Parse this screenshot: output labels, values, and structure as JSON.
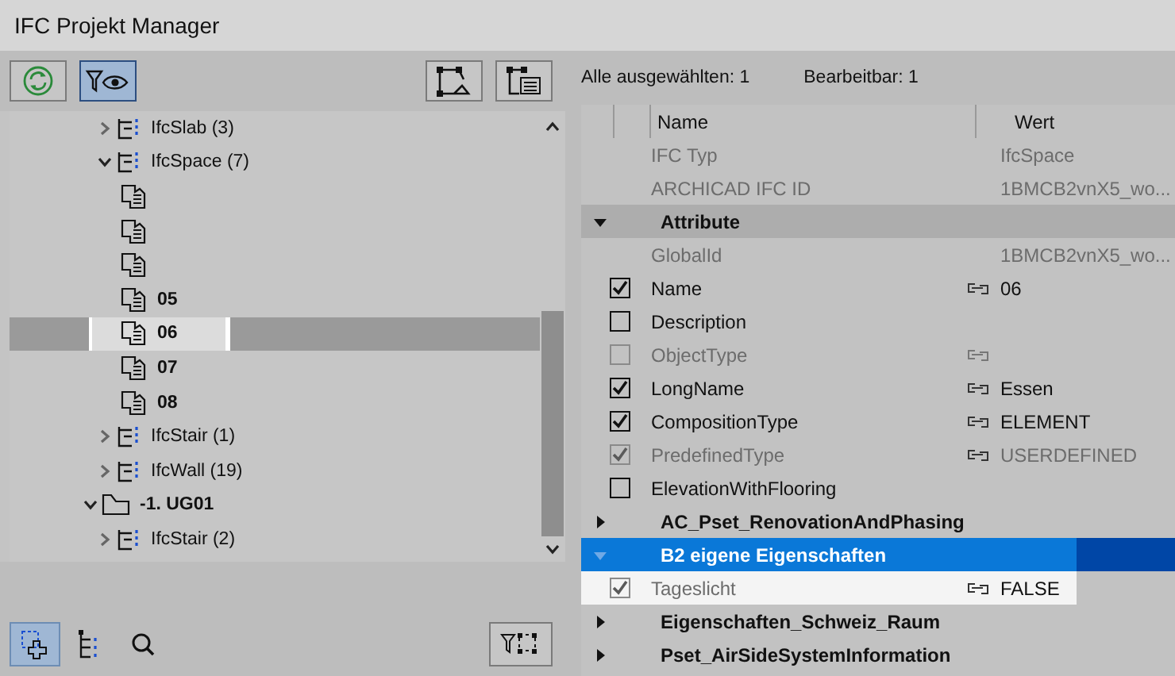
{
  "window": {
    "title": "IFC Projekt Manager"
  },
  "toolbar": {
    "buttons": [
      {
        "kind": "refresh",
        "selected": false
      },
      {
        "kind": "filter-eye",
        "selected": true
      },
      {
        "kind": "geometry",
        "selected": false
      },
      {
        "kind": "geometry-list",
        "selected": false
      }
    ]
  },
  "tree": {
    "scrolled_parent_children": [
      {
        "kind": "class",
        "label": "IfcSlab (3)",
        "expanded": false,
        "selected": false,
        "highlighted": false
      },
      {
        "kind": "class",
        "label": "IfcSpace (7)",
        "expanded": true,
        "selected": false,
        "highlighted": false,
        "children": [
          {
            "kind": "space",
            "selected": false,
            "highlighted": false
          },
          {
            "kind": "space",
            "selected": false,
            "highlighted": false
          },
          {
            "kind": "space",
            "selected": false,
            "highlighted": false
          },
          {
            "kind": "space",
            "label": "05",
            "selected": false,
            "highlighted": false
          },
          {
            "kind": "space",
            "label": "06",
            "selected": true,
            "highlighted": true
          },
          {
            "kind": "space",
            "label": "07",
            "selected": false,
            "highlighted": false
          },
          {
            "kind": "space",
            "label": "08",
            "selected": false,
            "highlighted": false
          }
        ]
      },
      {
        "kind": "class",
        "label": "IfcStair (1)",
        "expanded": false,
        "selected": false,
        "highlighted": false
      },
      {
        "kind": "class",
        "label": "IfcWall (19)",
        "expanded": false,
        "selected": false,
        "highlighted": false
      }
    ],
    "items": [
      {
        "kind": "storey",
        "label": "-1. UG01",
        "expanded": true,
        "selected": false,
        "highlighted": false,
        "children": [
          {
            "kind": "class",
            "label": "IfcStair (2)",
            "expanded": false,
            "selected": false,
            "highlighted": false
          }
        ]
      }
    ]
  },
  "bottom_toolbar": {
    "buttons": [
      {
        "kind": "select-add",
        "selected": true
      },
      {
        "kind": "tree",
        "selected": false
      },
      {
        "kind": "search",
        "selected": false
      },
      {
        "kind": "filter-select",
        "selected": false
      }
    ]
  },
  "summary": [
    {
      "label": "Alle ausgewählten: 1"
    },
    {
      "label": "Bearbeitbar: 1"
    }
  ],
  "table": {
    "columns": [
      "Name",
      "Wert"
    ],
    "rows": [
      {
        "kind": "info",
        "name": "IFC Typ",
        "value": "IfcSpace"
      },
      {
        "kind": "info",
        "name": "ARCHICAD IFC ID",
        "value": "1BMCB2vnX5_wo..."
      },
      {
        "kind": "group",
        "name": "Attribute",
        "expanded": true,
        "selected": false,
        "highlighted": false
      },
      {
        "kind": "info",
        "name": "GlobalId",
        "value": "1BMCB2vnX5_wo..."
      },
      {
        "kind": "attr",
        "name": "Name",
        "checked": true,
        "disabled": false,
        "linked": true,
        "value": "06",
        "highlighted": false
      },
      {
        "kind": "attr",
        "name": "Description",
        "checked": false,
        "disabled": false,
        "linked": false,
        "highlighted": false
      },
      {
        "kind": "attr",
        "name": "ObjectType",
        "checked": false,
        "disabled": true,
        "linked": true,
        "highlighted": false
      },
      {
        "kind": "attr",
        "name": "LongName",
        "checked": true,
        "disabled": false,
        "linked": true,
        "value": "Essen",
        "highlighted": false
      },
      {
        "kind": "attr",
        "name": "CompositionType",
        "checked": true,
        "disabled": false,
        "linked": true,
        "value": "ELEMENT",
        "highlighted": false
      },
      {
        "kind": "attr",
        "name": "PredefinedType",
        "checked": true,
        "disabled": true,
        "linked": true,
        "value": "USERDEFINED",
        "highlighted": false
      },
      {
        "kind": "attr",
        "name": "ElevationWithFlooring",
        "checked": false,
        "disabled": false,
        "linked": false,
        "highlighted": false
      },
      {
        "kind": "group",
        "name": "AC_Pset_RenovationAndPhasing",
        "expanded": false,
        "selected": false,
        "highlighted": false
      },
      {
        "kind": "group",
        "name": "B2 eigene Eigenschaften",
        "expanded": true,
        "selected": true,
        "highlighted": true
      },
      {
        "kind": "attr",
        "name": "Tageslicht",
        "checked": true,
        "disabled": true,
        "linked": true,
        "value": "FALSE",
        "highlighted": true
      },
      {
        "kind": "group",
        "name": "Eigenschaften_Schweiz_Raum",
        "expanded": false,
        "selected": false,
        "highlighted": false
      },
      {
        "kind": "group",
        "name": "Pset_AirSideSystemInformation",
        "expanded": false,
        "selected": false,
        "highlighted": false
      }
    ]
  }
}
